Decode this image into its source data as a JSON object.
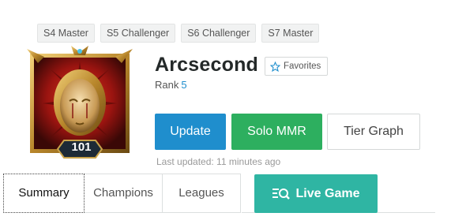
{
  "seasons": [
    {
      "label": "S4 Master"
    },
    {
      "label": "S5 Challenger"
    },
    {
      "label": "S6 Challenger"
    },
    {
      "label": "S7 Master"
    }
  ],
  "profile": {
    "level": "101",
    "name": "Arcsecond",
    "favorites_label": "Favorites",
    "rank_label": "Rank",
    "rank_value": "5"
  },
  "actions": {
    "update_label": "Update",
    "solo_mmr_label": "Solo MMR",
    "tier_graph_label": "Tier Graph"
  },
  "last_updated": "Last updated: 11 minutes ago",
  "tabs": [
    {
      "label": "Summary",
      "active": true
    },
    {
      "label": "Champions",
      "active": false
    },
    {
      "label": "Leagues",
      "active": false
    }
  ],
  "live_game_label": "Live Game",
  "colors": {
    "blue": "#1f8ecd",
    "green": "#2daf5f",
    "teal": "#2fb5a3"
  },
  "icons": {
    "favorites": "star-icon",
    "live_game": "live-search-icon"
  }
}
